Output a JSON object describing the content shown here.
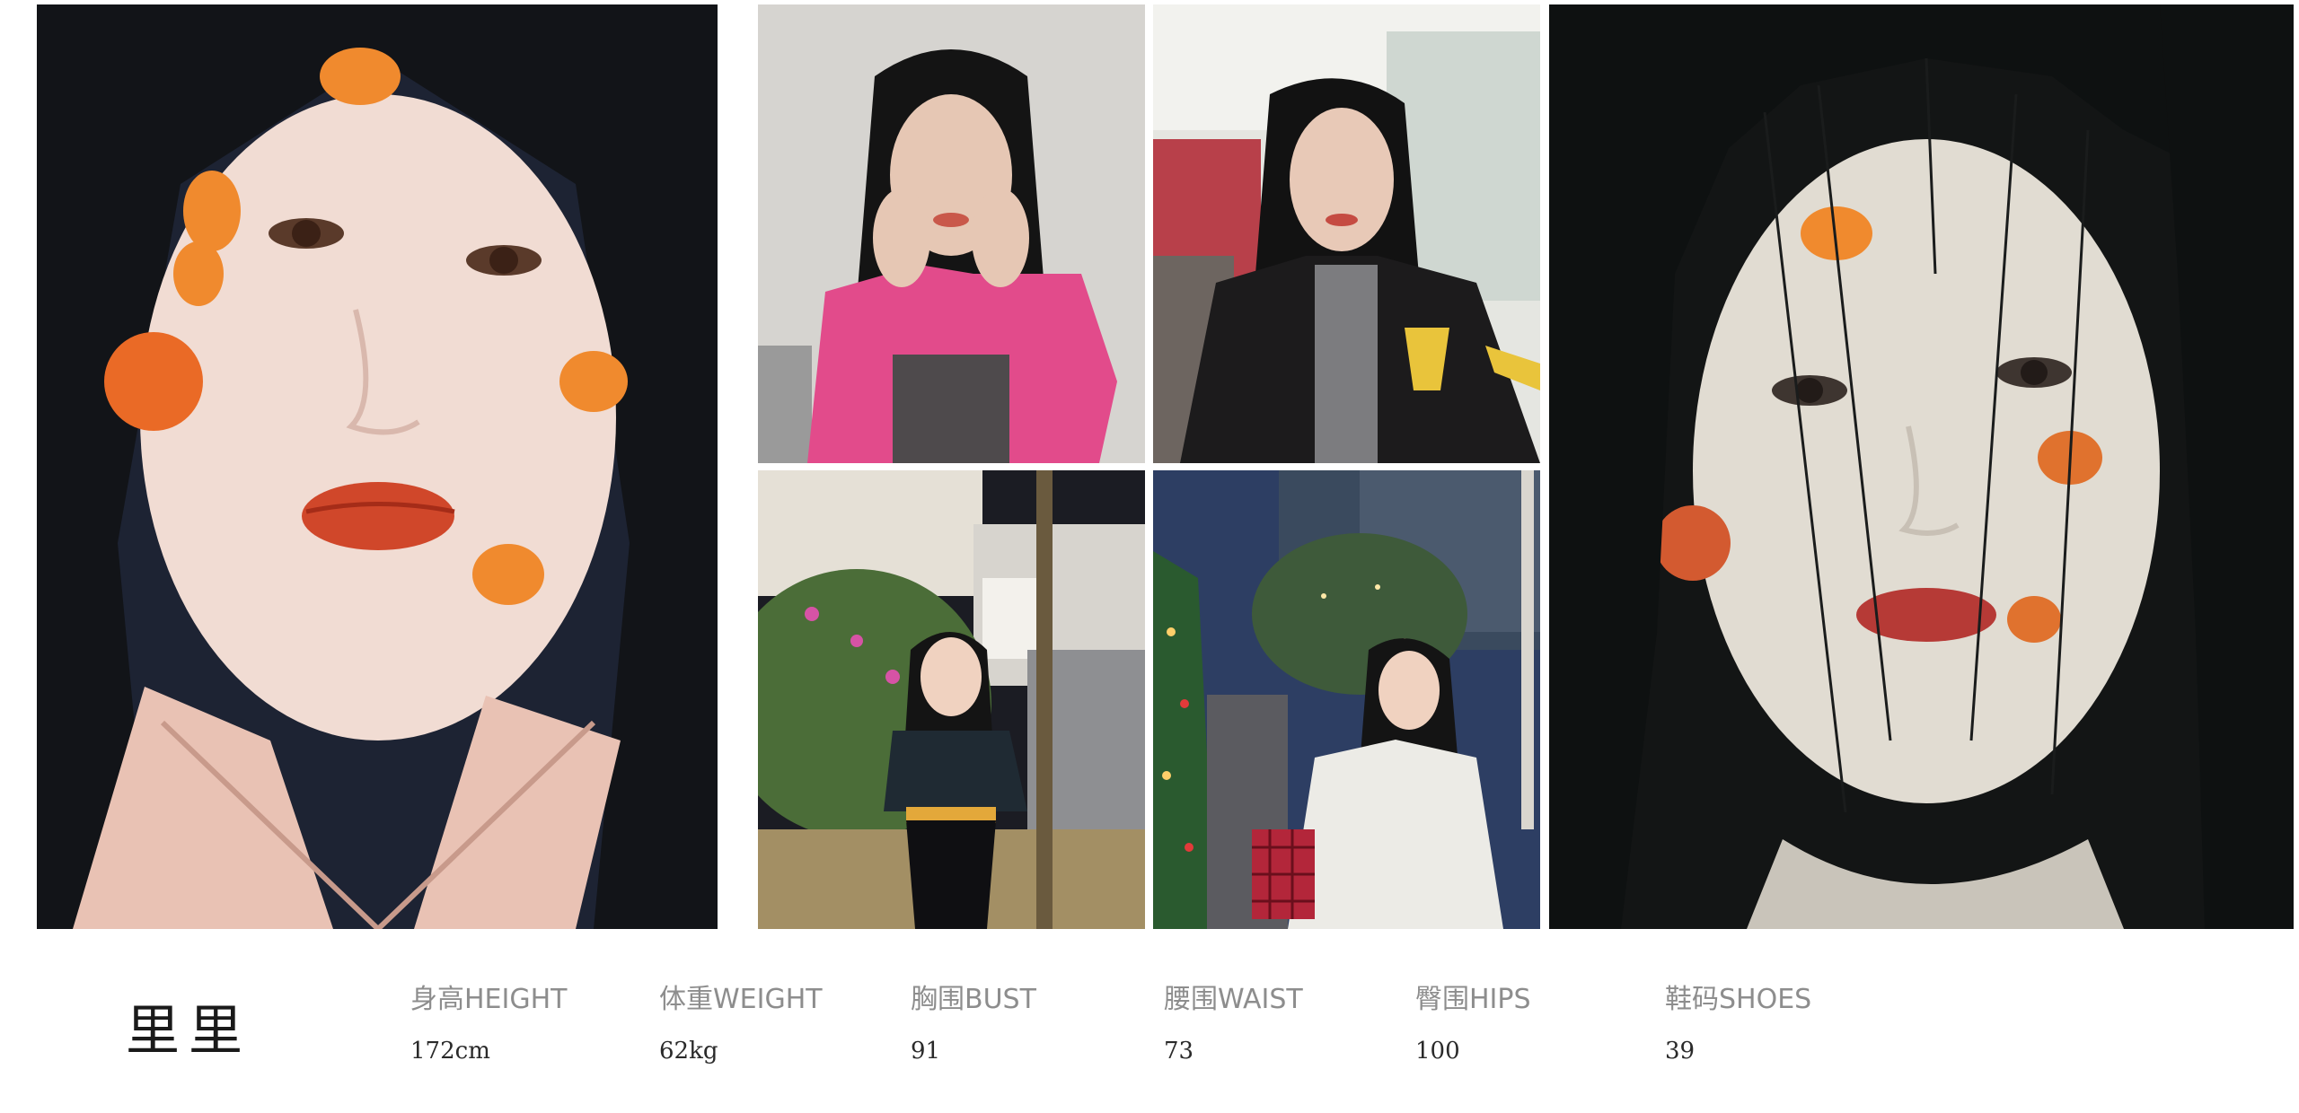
{
  "model": {
    "name": "里里"
  },
  "stats": [
    {
      "label": "身高HEIGHT",
      "value": "172cm"
    },
    {
      "label": "体重WEIGHT",
      "value": "62kg"
    },
    {
      "label": "胸围BUST",
      "value": "91"
    },
    {
      "label": "腰围WAIST",
      "value": "73"
    },
    {
      "label": "臀围HIPS",
      "value": "100"
    },
    {
      "label": "鞋码SHOES",
      "value": "39"
    }
  ],
  "colors": {
    "background": "#ffffff",
    "label": "#8d8d8d",
    "value": "#2a2a2a",
    "petal": "#f08a2e",
    "lip": "#d0472a",
    "hair": "#141414"
  }
}
